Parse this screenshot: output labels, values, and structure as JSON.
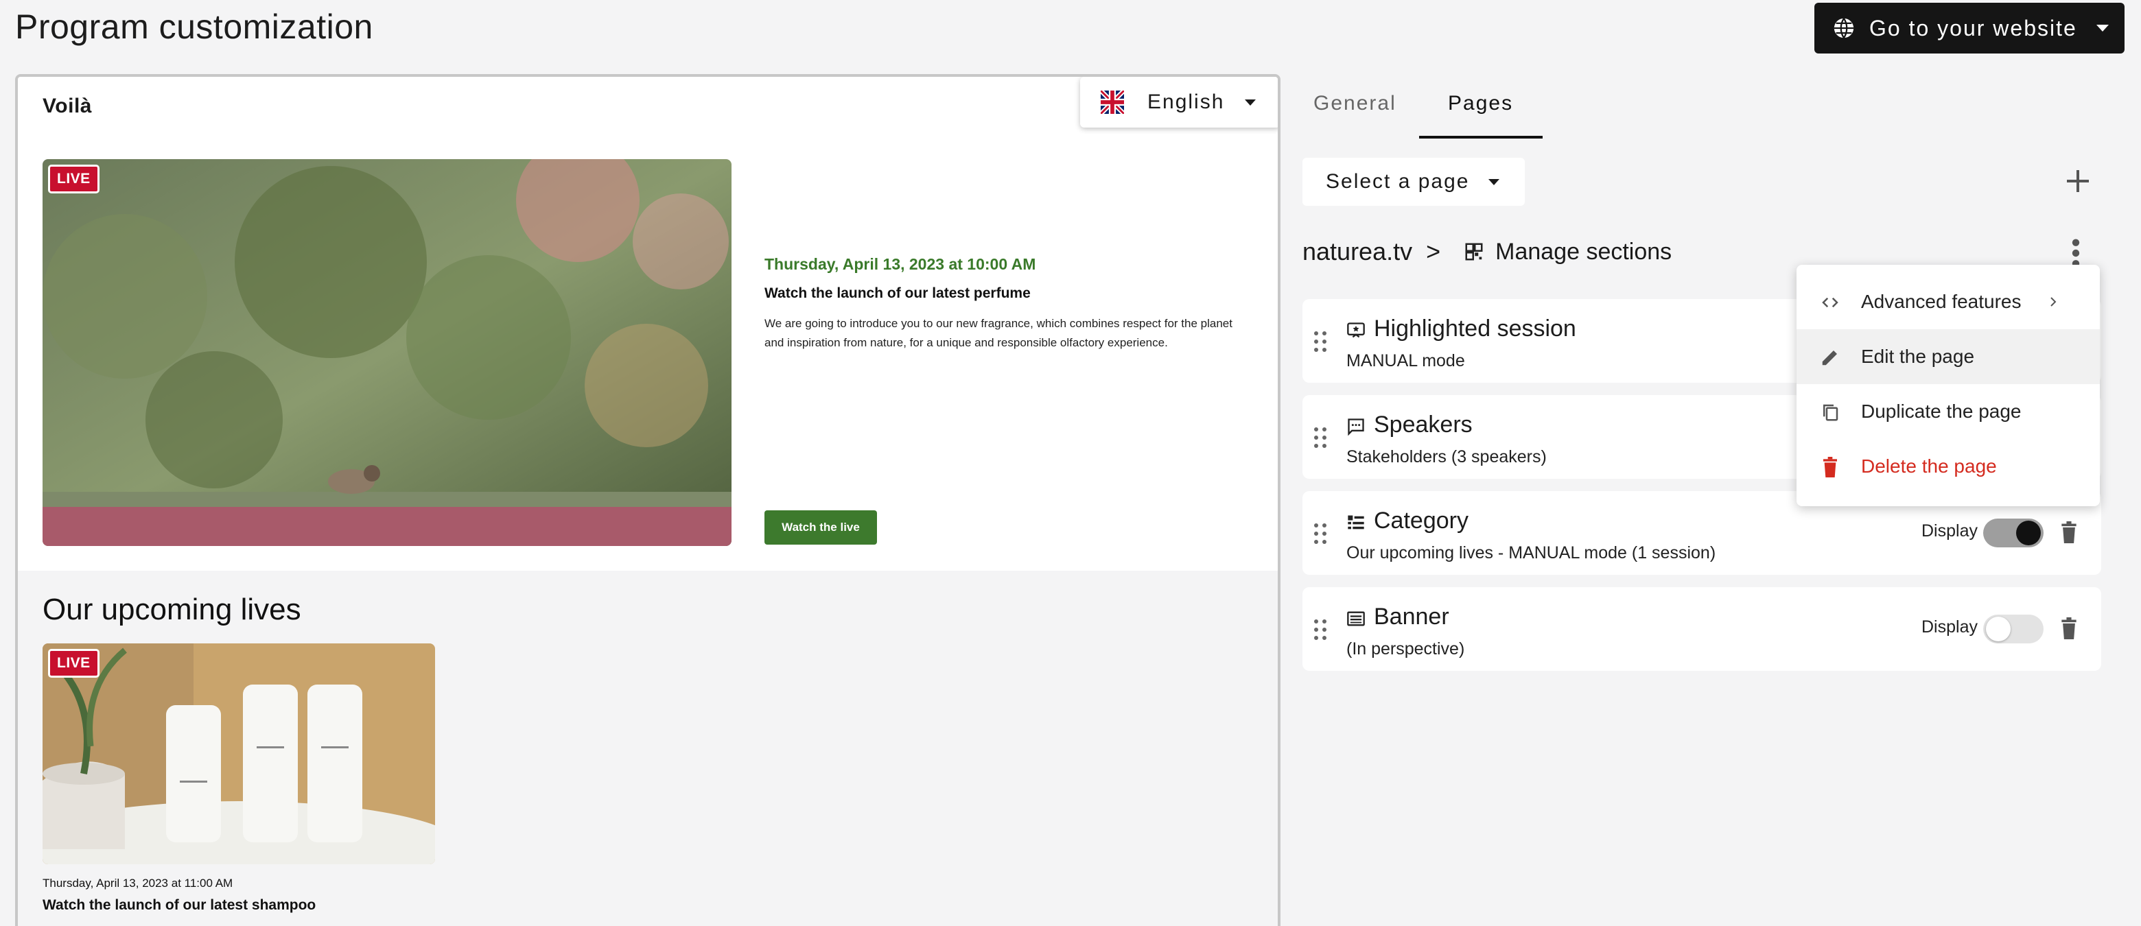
{
  "header": {
    "title": "Program customization",
    "website_button": "Go to your website",
    "icon": "globe-icon"
  },
  "preview": {
    "brand": "Voilà",
    "language": "English",
    "hero": {
      "badge": "LIVE",
      "date": "Thursday, April 13, 2023 at 10:00 AM",
      "title": "Watch the launch of our latest perfume",
      "description": "We are going to introduce you to our new fragrance, which combines respect for the planet and inspiration from nature, for a unique and responsible olfactory experience.",
      "button": "Watch the live"
    },
    "upcoming": {
      "heading": "Our upcoming lives",
      "badge": "LIVE",
      "date": "Thursday, April 13, 2023 at 11:00 AM",
      "title": "Watch the launch of our latest shampoo"
    }
  },
  "panel": {
    "tabs": [
      {
        "label": "General",
        "active": false
      },
      {
        "label": "Pages",
        "active": true
      }
    ],
    "select_page": "Select a page",
    "breadcrumb": {
      "site": "naturea.tv",
      "separator": ">",
      "current": "Manage sections"
    },
    "sections": [
      {
        "title": "Highlighted session",
        "subtitle": "MANUAL mode",
        "icon": "highlight-icon"
      },
      {
        "title": "Speakers",
        "subtitle": "Stakeholders (3 speakers)",
        "icon": "speakers-icon"
      },
      {
        "title": "Category",
        "subtitle": "Our upcoming lives - MANUAL mode (1 session)",
        "icon": "category-icon",
        "display_label": "Display",
        "display": true
      },
      {
        "title": "Banner",
        "subtitle": "(In perspective)",
        "icon": "banner-icon",
        "display_label": "Display",
        "display": false
      }
    ],
    "menu": [
      {
        "label": "Advanced features",
        "icon": "code-icon",
        "has_submenu": true
      },
      {
        "label": "Edit the page",
        "icon": "pencil-icon",
        "highlighted": true
      },
      {
        "label": "Duplicate the page",
        "icon": "copy-icon"
      },
      {
        "label": "Delete the page",
        "icon": "trash-icon",
        "danger": true,
        "color": "#d42b1f"
      }
    ]
  },
  "colors": {
    "accent_green": "#3d7a2d",
    "live_red": "#c8102e",
    "danger": "#d42b1f",
    "dark_button": "#151515"
  }
}
